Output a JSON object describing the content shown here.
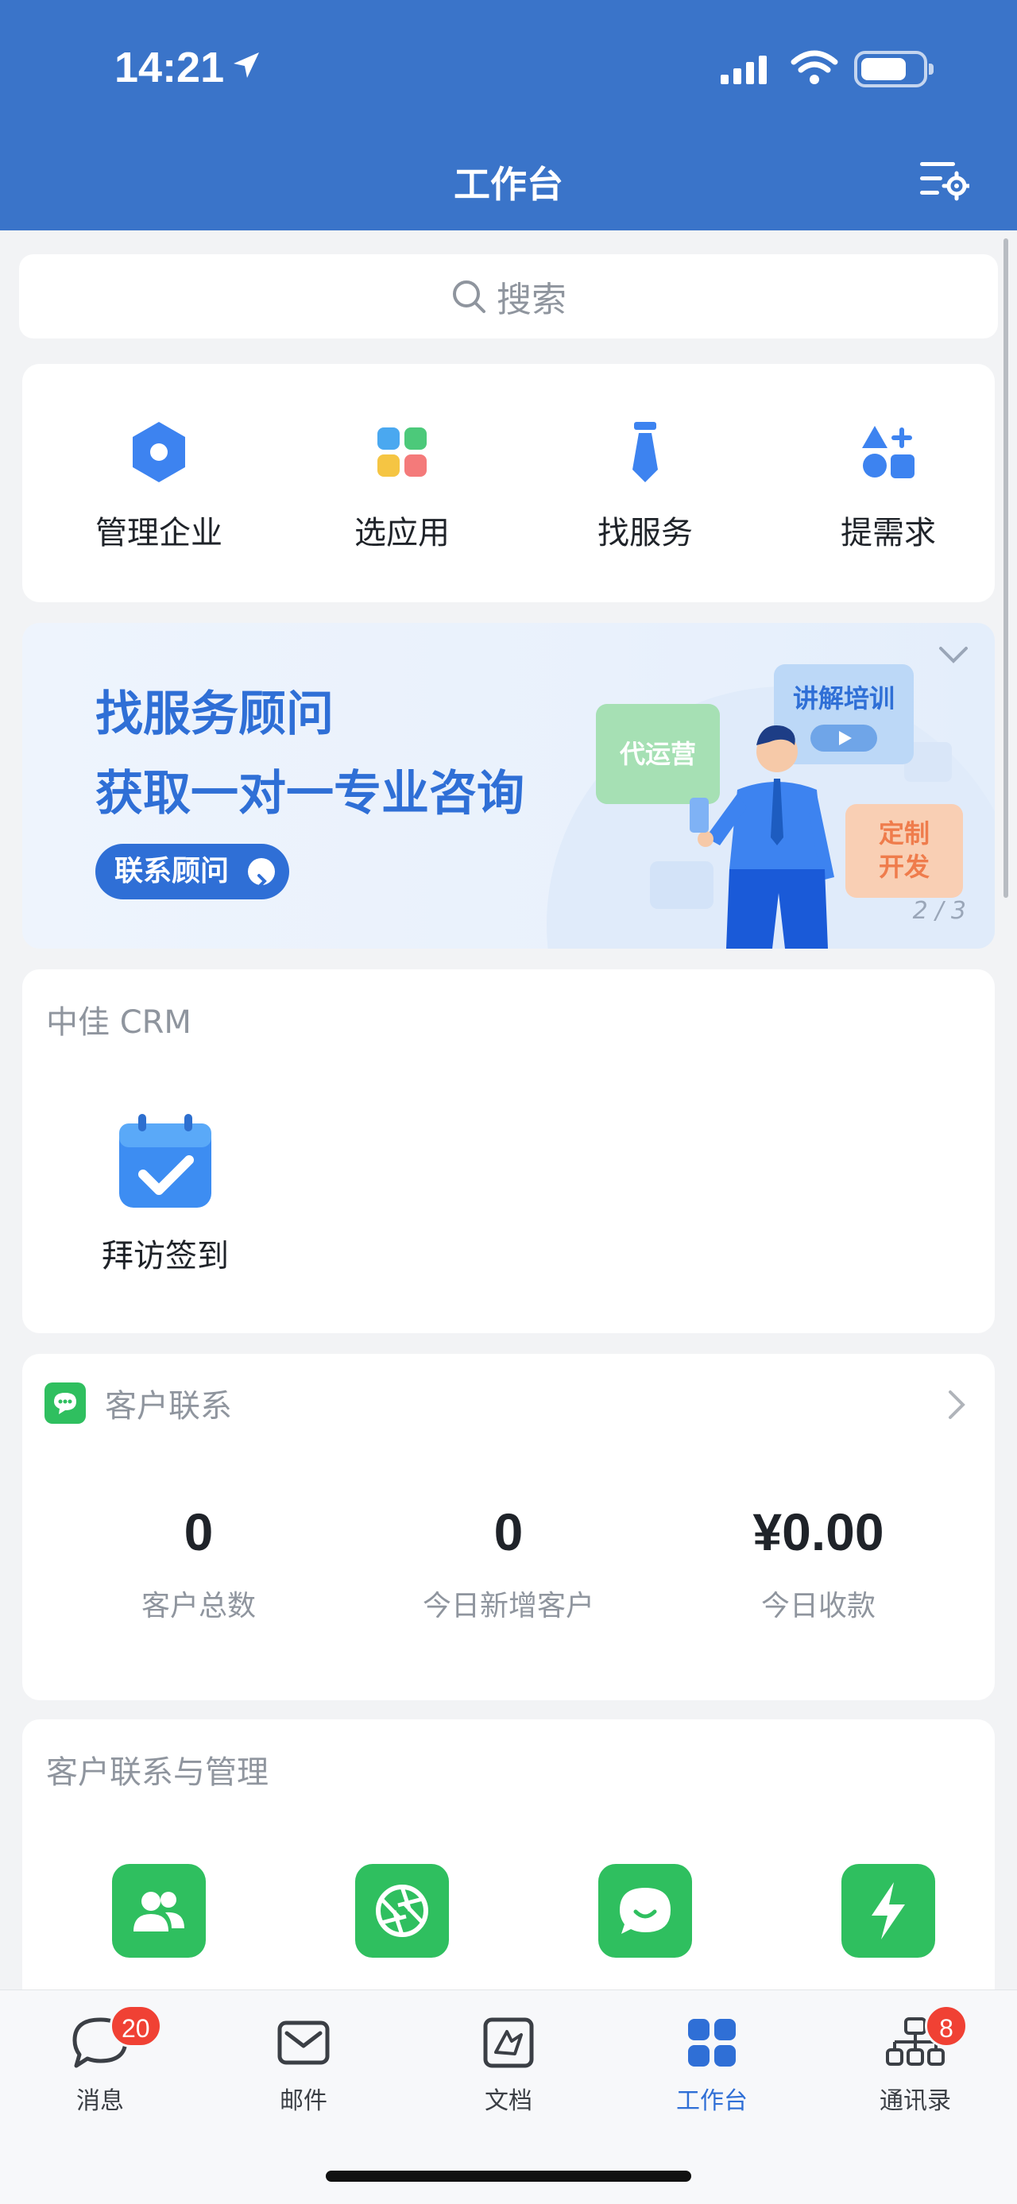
{
  "status_bar": {
    "time": "14:21"
  },
  "header": {
    "title": "工作台"
  },
  "search": {
    "placeholder": "搜索"
  },
  "quick_actions": [
    {
      "label": "管理企业",
      "icon": "hexagon-icon"
    },
    {
      "label": "选应用",
      "icon": "apps-grid-icon"
    },
    {
      "label": "找服务",
      "icon": "tie-icon"
    },
    {
      "label": "提需求",
      "icon": "shapes-plus-icon"
    }
  ],
  "banner": {
    "line1": "找服务顾问",
    "line2": "获取一对一专业咨询",
    "button_label": "联系顾问",
    "tag_ops": "代运营",
    "tag_training": "讲解培训",
    "tag_custom_1": "定制",
    "tag_custom_2": "开发",
    "pager": "2 / 3"
  },
  "crm": {
    "title": "中佳 CRM",
    "items": [
      {
        "label": "拜访签到",
        "icon": "calendar-check-icon"
      }
    ]
  },
  "customer_contact": {
    "title": "客户联系",
    "stats": [
      {
        "value": "0",
        "label": "客户总数"
      },
      {
        "value": "0",
        "label": "今日新增客户"
      },
      {
        "value": "¥0.00",
        "label": "今日收款"
      }
    ]
  },
  "customer_management": {
    "title": "客户联系与管理"
  },
  "tabbar": {
    "items": [
      {
        "label": "消息",
        "badge": "20"
      },
      {
        "label": "邮件",
        "badge": ""
      },
      {
        "label": "文档",
        "badge": ""
      },
      {
        "label": "工作台",
        "badge": ""
      },
      {
        "label": "通讯录",
        "badge": "8"
      }
    ]
  },
  "colors": {
    "header_bg": "#3a74c9",
    "accent": "#2f6fd6",
    "green": "#2fbf5f",
    "badge": "#f04134"
  }
}
